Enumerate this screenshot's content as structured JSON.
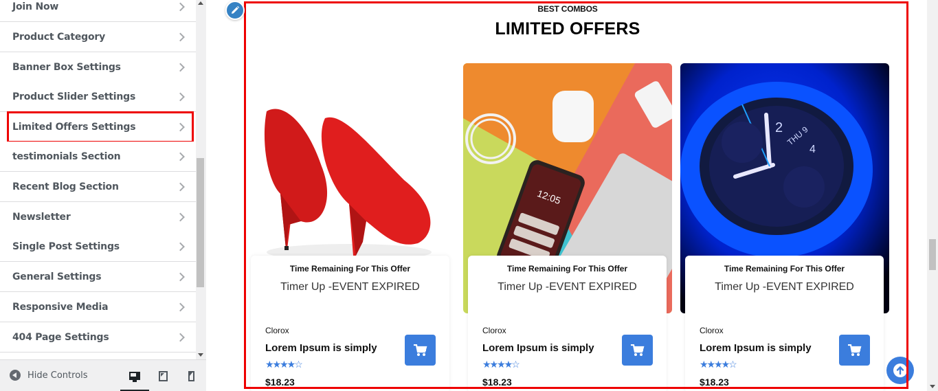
{
  "sidebar": {
    "items": [
      {
        "label": "Join Now"
      },
      {
        "label": "Product Category"
      },
      {
        "label": "Banner Box Settings"
      },
      {
        "label": "Product Slider Settings"
      },
      {
        "label": "Limited Offers Settings",
        "highlighted": true
      },
      {
        "label": "testimonials Section"
      },
      {
        "label": "Recent Blog Section"
      },
      {
        "label": "Newsletter"
      },
      {
        "label": "Single Post Settings"
      },
      {
        "label": "General Settings"
      },
      {
        "label": "Responsive Media"
      },
      {
        "label": "404 Page Settings"
      }
    ],
    "footer": {
      "hide_controls_label": "Hide Controls",
      "devices": [
        {
          "icon": "desktop-icon",
          "active": true
        },
        {
          "icon": "tablet-icon",
          "active": false
        },
        {
          "icon": "mobile-icon",
          "active": false
        }
      ]
    }
  },
  "preview": {
    "section_subtitle": "BEST COMBOS",
    "section_title": "LIMITED OFFERS",
    "highlight_color": "#ee0000",
    "accent_color": "#3b7ddd",
    "products": [
      {
        "image": "red-high-heels",
        "timer_label": "Time Remaining For This Offer",
        "timer_value": "Timer Up -EVENT EXPIRED",
        "brand": "Clorox",
        "name": "Lorem Ipsum is simply",
        "rating": 4,
        "rating_max": 5,
        "stars": "★★★★☆",
        "price": "$18.23"
      },
      {
        "image": "gadgets-flatlay",
        "timer_label": "Time Remaining For This Offer",
        "timer_value": "Timer Up -EVENT EXPIRED",
        "brand": "Clorox",
        "name": "Lorem Ipsum is simply",
        "rating": 4,
        "rating_max": 5,
        "stars": "★★★★☆",
        "price": "$18.23"
      },
      {
        "image": "smartwatch-blue",
        "timer_label": "Time Remaining For This Offer",
        "timer_value": "Timer Up -EVENT EXPIRED",
        "brand": "Clorox",
        "name": "Lorem Ipsum is simply",
        "rating": 4,
        "rating_max": 5,
        "stars": "★★★★☆",
        "price": "$18.23"
      }
    ]
  }
}
